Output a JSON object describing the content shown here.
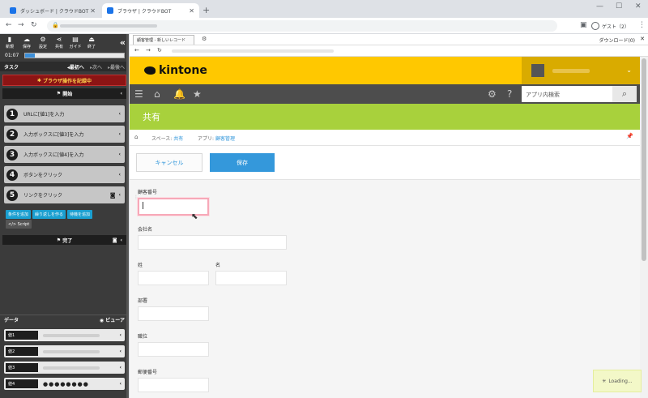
{
  "browser": {
    "tabs": [
      {
        "title": "ダッシュボード | クラウドBOT"
      },
      {
        "title": "ブラウザ | クラウドBOT"
      }
    ],
    "guest_label": "ゲスト（2）"
  },
  "bot": {
    "tools": [
      "新規",
      "保存",
      "設定",
      "共有",
      "ガイド",
      "終了"
    ],
    "timer": "01:07",
    "progress_fraction": 0.1,
    "task_label": "タスク",
    "nav": {
      "first": "最初へ",
      "next": "次へ",
      "last": "最後へ"
    },
    "record_label": "ブラウザ操作を記録中",
    "start_label": "開始",
    "steps": [
      {
        "num": "1",
        "label": "URLに[値1]を入力"
      },
      {
        "num": "2",
        "label": "入力ボックスに[値3]を入力"
      },
      {
        "num": "3",
        "label": "入力ボックスに[値4]を入力"
      },
      {
        "num": "4",
        "label": "ボタンをクリック"
      },
      {
        "num": "5",
        "label": "リンクをクリック"
      }
    ],
    "add_buttons": [
      "条件を追加",
      "繰り返しを作る",
      "待機を追加"
    ],
    "script_label": "Script",
    "end_label": "完了",
    "data_label": "データ",
    "view_label": "ビューア",
    "vars": [
      {
        "name": "値1",
        "value": ""
      },
      {
        "name": "値2",
        "value": ""
      },
      {
        "name": "値3",
        "value": ""
      },
      {
        "name": "値4",
        "value": "●●●●●●●●"
      }
    ]
  },
  "viewer": {
    "tab_title": "顧客管理 - 新しいレコード",
    "download_label": "ダウンロード(0)"
  },
  "kintone": {
    "logo": "kintone",
    "search_placeholder": "アプリ内検索",
    "space_name": "共有",
    "breadcrumb": {
      "space_prefix": "スペース: ",
      "space": "共有",
      "app_prefix": "アプリ: ",
      "app": "顧客管理"
    },
    "cancel_label": "キャンセル",
    "save_label": "保存",
    "fields": {
      "customer_no": "顧客番号",
      "company": "会社名",
      "last_name": "姓",
      "first_name": "名",
      "department": "部署",
      "position": "職位",
      "postal_code": "郵便番号"
    },
    "loading_text": "Loading..."
  }
}
